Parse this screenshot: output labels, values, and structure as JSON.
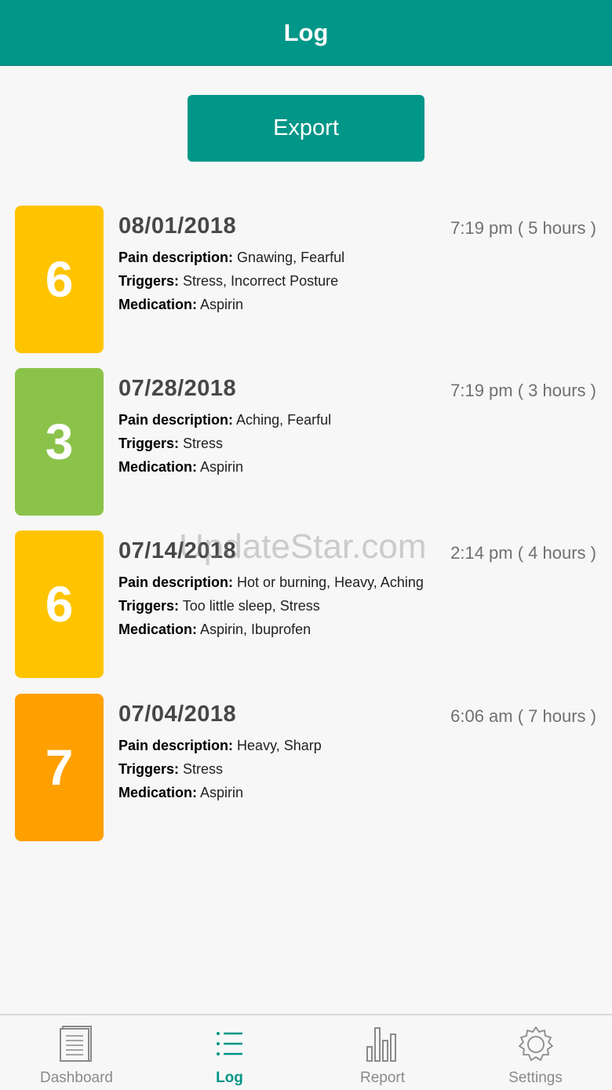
{
  "header": {
    "title": "Log"
  },
  "export": {
    "label": "Export"
  },
  "entries": [
    {
      "score": "6",
      "color": "#FFC400",
      "date": "08/01/2018",
      "time": "7:19 pm ( 5 hours )",
      "pain_label": "Pain description:",
      "pain": "Gnawing, Fearful",
      "triggers_label": "Triggers:",
      "triggers": "Stress, Incorrect Posture",
      "medication_label": "Medication:",
      "medication": "Aspirin"
    },
    {
      "score": "3",
      "color": "#8BC34A",
      "date": "07/28/2018",
      "time": "7:19 pm ( 3 hours )",
      "pain_label": "Pain description:",
      "pain": "Aching, Fearful",
      "triggers_label": "Triggers:",
      "triggers": "Stress",
      "medication_label": "Medication:",
      "medication": "Aspirin"
    },
    {
      "score": "6",
      "color": "#FFC400",
      "date": "07/14/2018",
      "time": "2:14 pm ( 4 hours )",
      "pain_label": "Pain description:",
      "pain": "Hot or burning, Heavy, Aching",
      "triggers_label": "Triggers:",
      "triggers": "Too little sleep, Stress",
      "medication_label": "Medication:",
      "medication": "Aspirin, Ibuprofen"
    },
    {
      "score": "7",
      "color": "#FFA000",
      "date": "07/04/2018",
      "time": "6:06 am ( 7 hours )",
      "pain_label": "Pain description:",
      "pain": "Heavy, Sharp",
      "triggers_label": "Triggers:",
      "triggers": "Stress",
      "medication_label": "Medication:",
      "medication": "Aspirin"
    }
  ],
  "watermark": "UpdateStar.com",
  "nav": {
    "items": [
      {
        "label": "Dashboard",
        "icon": "dashboard-icon"
      },
      {
        "label": "Log",
        "icon": "list-icon"
      },
      {
        "label": "Report",
        "icon": "bar-chart-icon"
      },
      {
        "label": "Settings",
        "icon": "gear-icon"
      }
    ],
    "active_index": 1
  },
  "colors": {
    "primary": "#009688",
    "nav_inactive": "#8a8a8a"
  }
}
